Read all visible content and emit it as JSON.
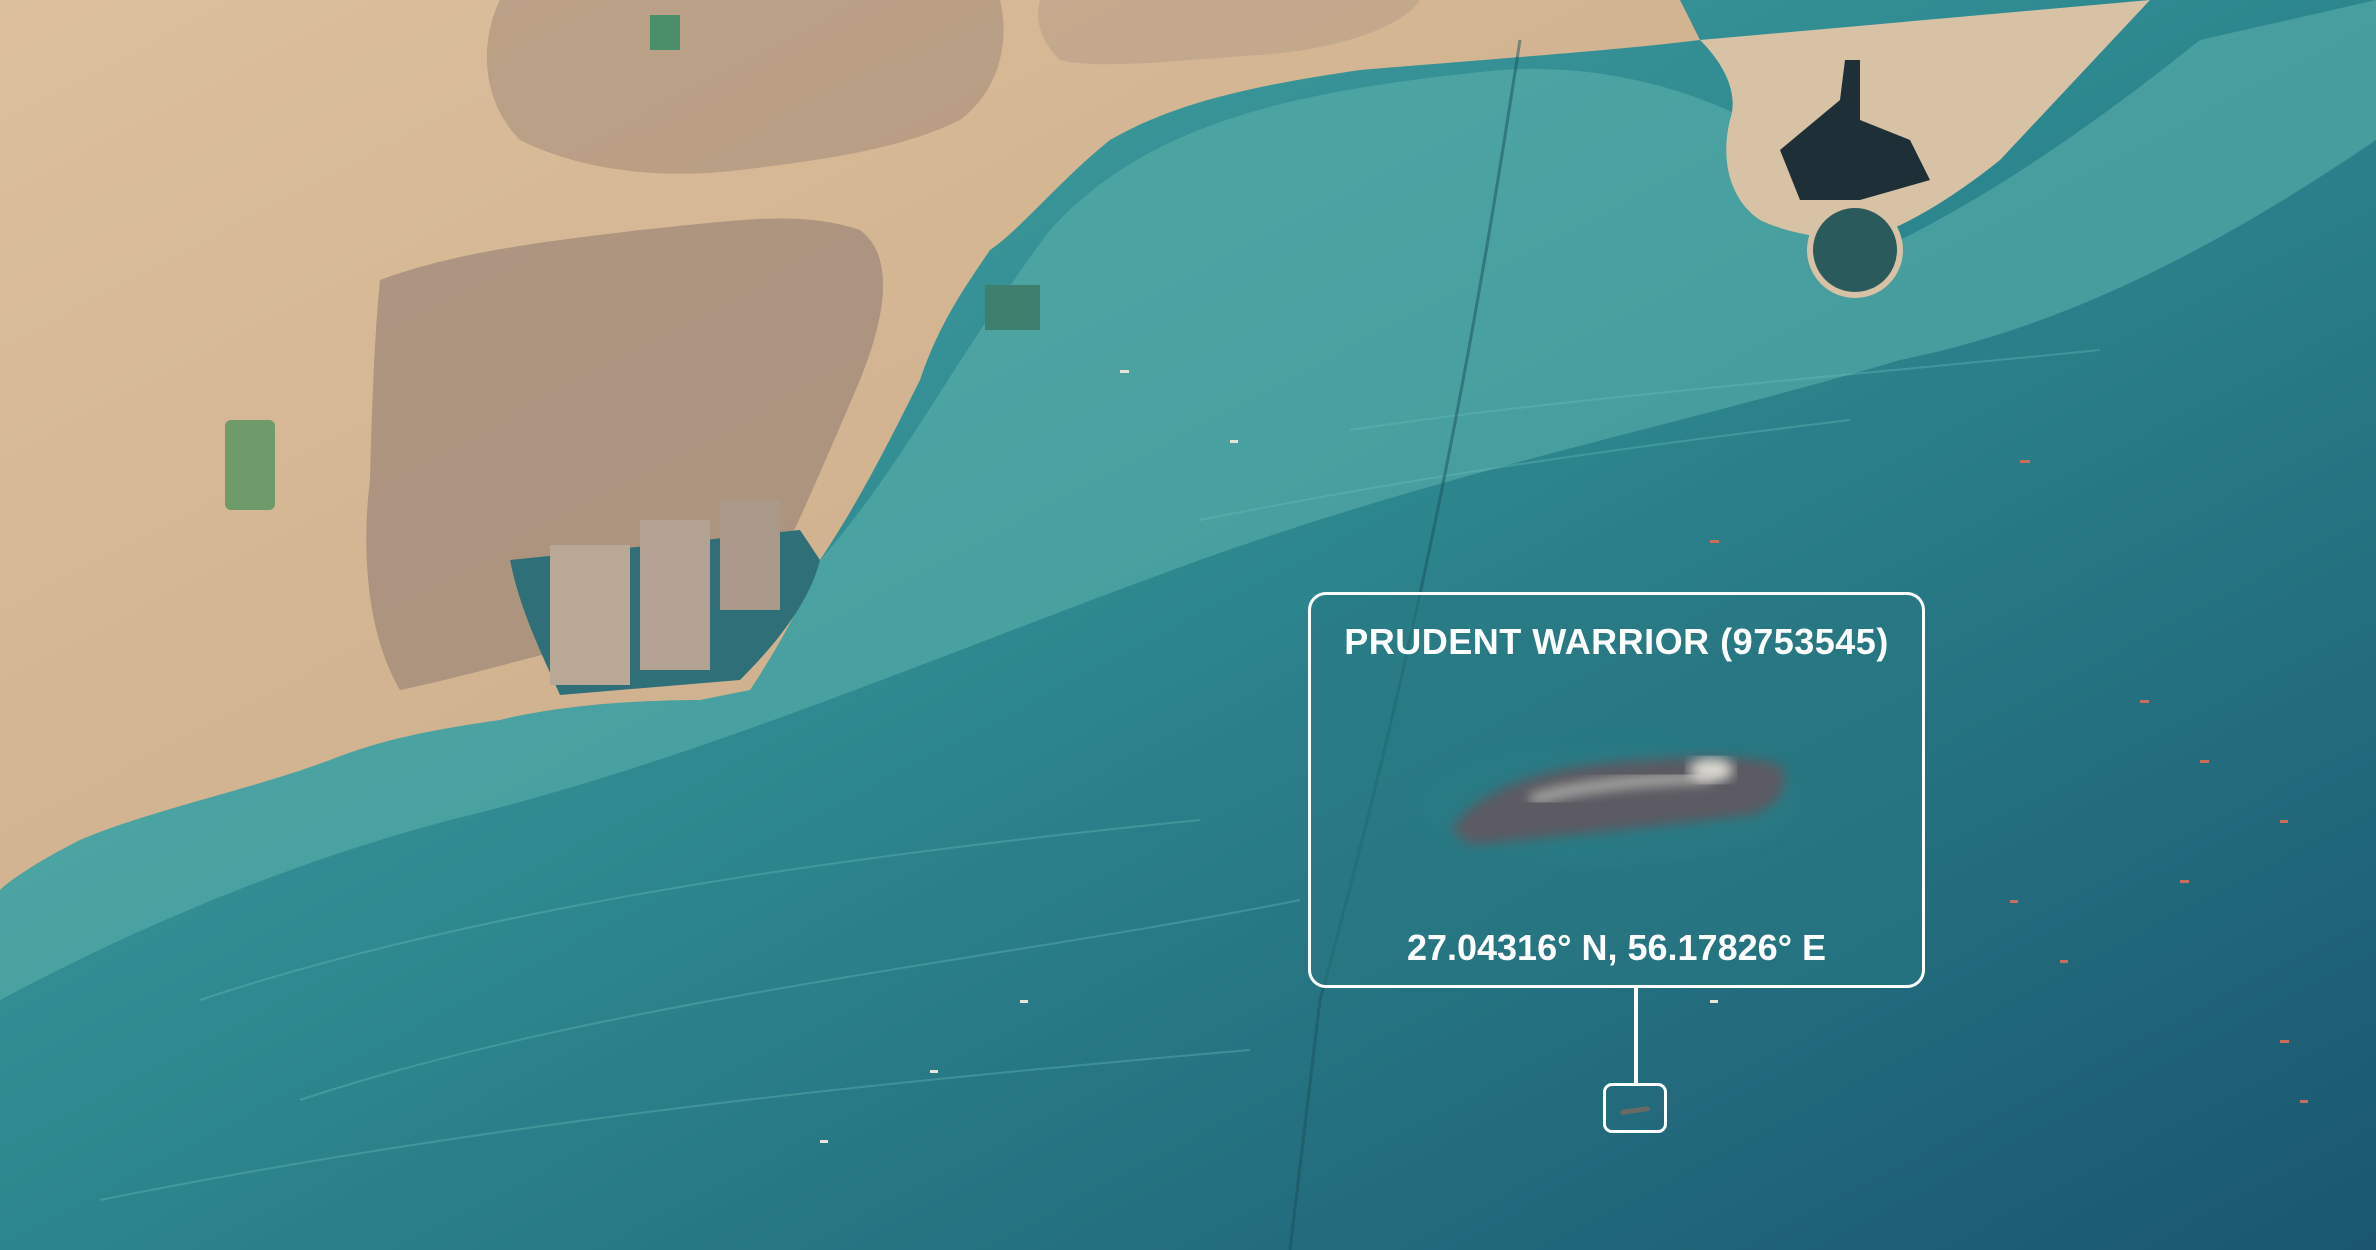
{
  "callout": {
    "vessel": "PRUDENT WARRIOR (9753545)",
    "coordinates": "27.04316° N, 56.17826° E"
  },
  "colors": {
    "sea_shallow": "#3f9a9b",
    "sea_deep": "#1f5f6e",
    "land": "#d8b895",
    "urban": "#8a7a70",
    "callout_border": "#ffffff"
  }
}
